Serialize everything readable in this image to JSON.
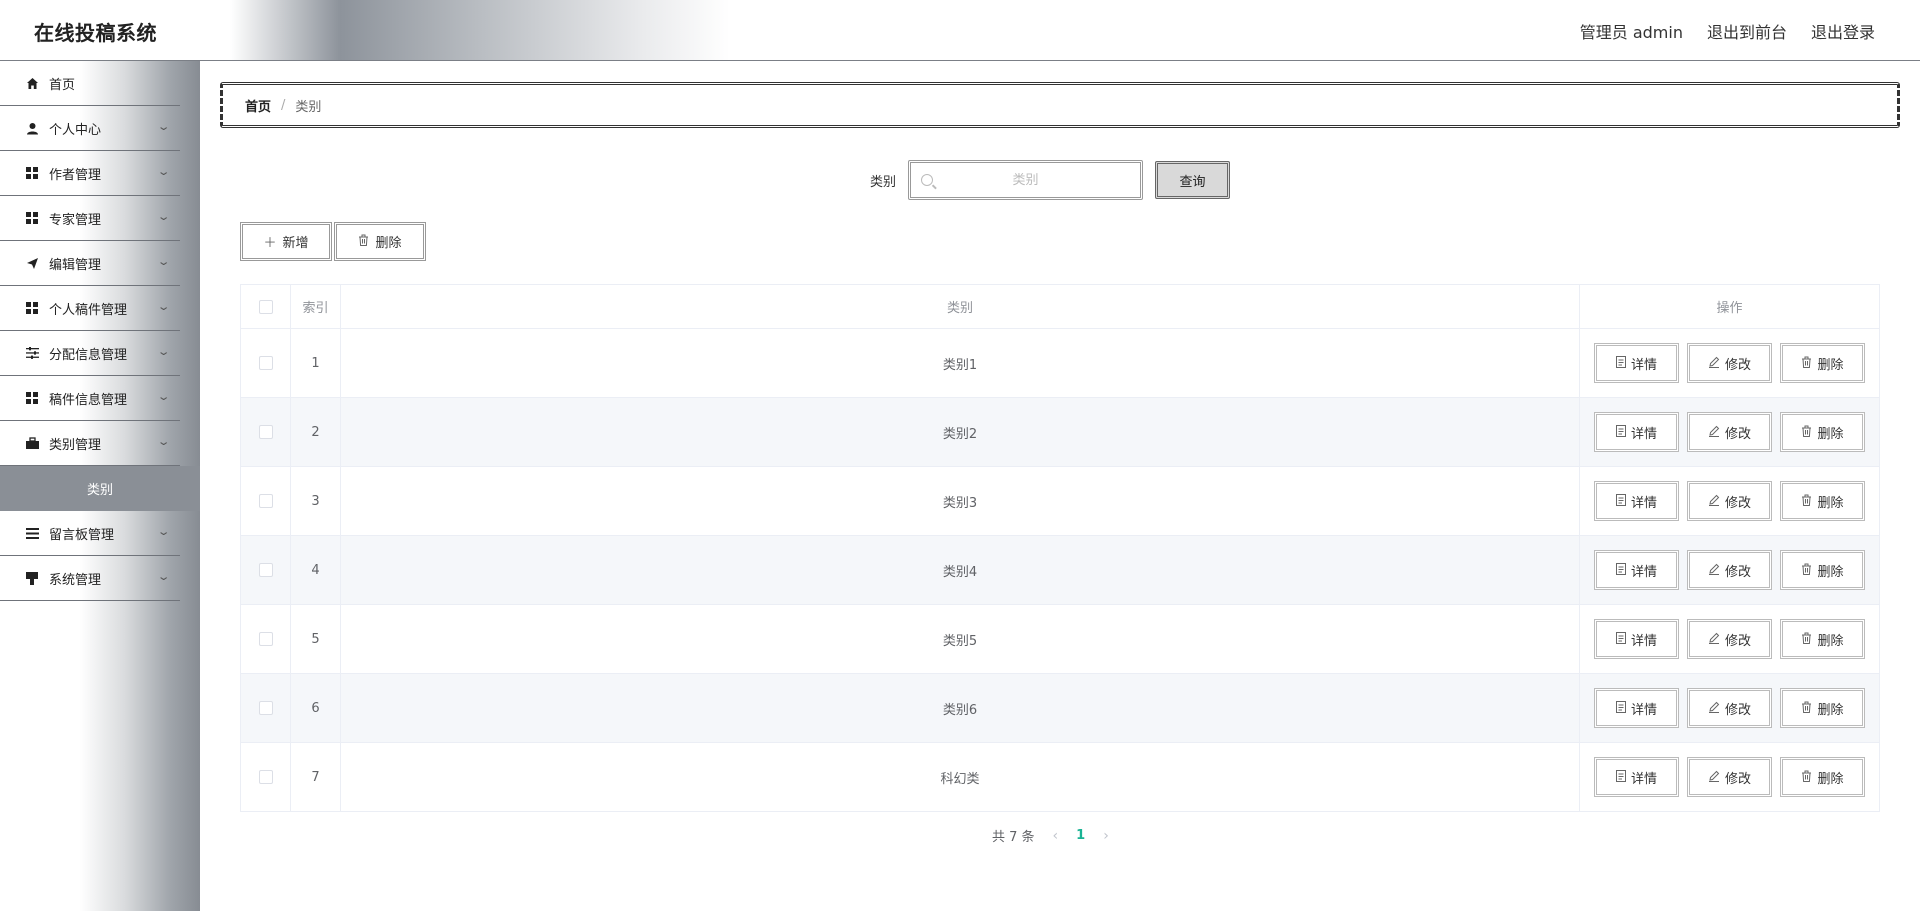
{
  "header": {
    "title": "在线投稿系统",
    "user": "管理员 admin",
    "to_front": "退出到前台",
    "logout": "退出登录"
  },
  "sidebar": {
    "items": [
      {
        "label": "首页",
        "icon": "home-icon"
      },
      {
        "label": "个人中心",
        "icon": "user-icon"
      },
      {
        "label": "作者管理",
        "icon": "grid-icon"
      },
      {
        "label": "专家管理",
        "icon": "grid-icon"
      },
      {
        "label": "编辑管理",
        "icon": "send-icon"
      },
      {
        "label": "个人稿件管理",
        "icon": "grid-icon"
      },
      {
        "label": "分配信息管理",
        "icon": "sliders-icon"
      },
      {
        "label": "稿件信息管理",
        "icon": "grid-icon"
      },
      {
        "label": "类别管理",
        "icon": "suitcase-icon"
      },
      {
        "label": "留言板管理",
        "icon": "menu-icon"
      },
      {
        "label": "系统管理",
        "icon": "stamp-icon"
      }
    ],
    "active_sub": "类别"
  },
  "breadcrumb": {
    "home": "首页",
    "sep": "/",
    "current": "类别"
  },
  "search": {
    "label": "类别",
    "placeholder": "类别",
    "button": "查询"
  },
  "actions": {
    "add": "新增",
    "delete": "删除"
  },
  "table": {
    "headers": {
      "index": "索引",
      "category": "类别",
      "ops": "操作"
    },
    "rows": [
      {
        "index": "1",
        "category": "类别1"
      },
      {
        "index": "2",
        "category": "类别2"
      },
      {
        "index": "3",
        "category": "类别3"
      },
      {
        "index": "4",
        "category": "类别4"
      },
      {
        "index": "5",
        "category": "类别5"
      },
      {
        "index": "6",
        "category": "类别6"
      },
      {
        "index": "7",
        "category": "科幻类"
      }
    ],
    "op_labels": {
      "detail": "详情",
      "edit": "修改",
      "delete": "删除"
    }
  },
  "pager": {
    "total": "共 7 条",
    "current_page": "1"
  },
  "colors": {
    "accent": "#1ab394",
    "sidebar_active": "#8a8f96"
  }
}
